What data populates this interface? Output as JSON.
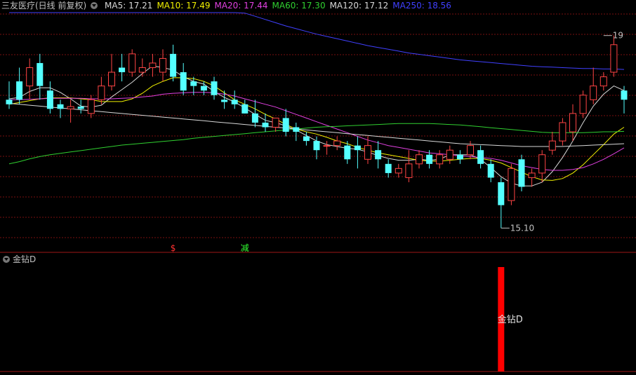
{
  "header": {
    "title": "三友医疗(日线 前复权)",
    "indicators": [
      {
        "label": "MA5:",
        "value": "17.21",
        "color": "#d8d8d8"
      },
      {
        "label": "MA10:",
        "value": "17.49",
        "color": "#f0f000"
      },
      {
        "label": "MA20:",
        "value": "17.44",
        "color": "#e040e0"
      },
      {
        "label": "MA60:",
        "value": "17.30",
        "color": "#30d030"
      },
      {
        "label": "MA120:",
        "value": "17.12",
        "color": "#d8d8d8"
      },
      {
        "label": "MA250:",
        "value": "18.56",
        "color": "#4040ff"
      }
    ]
  },
  "subpanel": {
    "title": "金钻D"
  },
  "colors": {
    "up": "#ff4444",
    "down": "#54ffff",
    "grid": "#7a1010",
    "separator": "#a01818"
  },
  "chart_data": [
    {
      "type": "candlestick",
      "ylim": [
        14.8,
        19.8
      ],
      "grid": true,
      "annotations": [
        {
          "text": "15.10",
          "index": 48,
          "price": 15.1
        },
        {
          "text": "19",
          "index": 58,
          "price": 19.3
        },
        {
          "text": "$",
          "index": 16,
          "color": "#ff3030"
        },
        {
          "text": "减",
          "index": 23,
          "color": "#30ff30"
        }
      ],
      "candles": [
        [
          17.9,
          17.8,
          18.3,
          17.7
        ],
        [
          18.3,
          17.9,
          18.6,
          17.8
        ],
        [
          18.2,
          18.6,
          18.8,
          17.9
        ],
        [
          18.7,
          18.2,
          18.9,
          17.9
        ],
        [
          18.1,
          17.7,
          18.3,
          17.6
        ],
        [
          17.8,
          17.7,
          17.9,
          17.5
        ],
        [
          17.7,
          17.75,
          17.9,
          17.4
        ],
        [
          17.75,
          17.7,
          17.9,
          17.6
        ],
        [
          17.6,
          17.9,
          18.0,
          17.5
        ],
        [
          17.9,
          18.2,
          18.4,
          17.8
        ],
        [
          18.2,
          18.5,
          18.9,
          18.1
        ],
        [
          18.6,
          18.5,
          18.9,
          18.3
        ],
        [
          18.5,
          18.9,
          19.0,
          18.4
        ],
        [
          18.5,
          18.6,
          18.8,
          18.4
        ],
        [
          18.6,
          18.7,
          18.9,
          18.4
        ],
        [
          18.5,
          18.8,
          19.0,
          18.3
        ],
        [
          18.9,
          18.4,
          19.1,
          18.3
        ],
        [
          18.5,
          18.1,
          18.7,
          18.0
        ],
        [
          18.3,
          18.2,
          18.4,
          18.0
        ],
        [
          18.2,
          18.1,
          18.3,
          18.0
        ],
        [
          18.3,
          18.0,
          18.4,
          17.9
        ],
        [
          17.9,
          17.85,
          18.1,
          17.7
        ],
        [
          17.9,
          17.8,
          18.1,
          17.7
        ],
        [
          17.8,
          17.6,
          17.9,
          17.6
        ],
        [
          17.6,
          17.4,
          17.9,
          17.3
        ],
        [
          17.4,
          17.3,
          17.6,
          17.2
        ],
        [
          17.3,
          17.5,
          17.5,
          17.2
        ],
        [
          17.5,
          17.2,
          17.7,
          17.1
        ],
        [
          17.3,
          17.2,
          17.4,
          17.0
        ],
        [
          17.1,
          17.0,
          17.2,
          16.9
        ],
        [
          17.0,
          16.8,
          17.1,
          16.6
        ],
        [
          16.9,
          16.9,
          17.0,
          16.7
        ],
        [
          16.9,
          17.0,
          17.1,
          16.8
        ],
        [
          16.9,
          16.6,
          17.0,
          16.5
        ],
        [
          16.9,
          16.8,
          17.1,
          16.4
        ],
        [
          16.6,
          16.9,
          17.1,
          16.5
        ],
        [
          16.8,
          16.6,
          17.0,
          16.4
        ],
        [
          16.5,
          16.3,
          16.6,
          16.2
        ],
        [
          16.3,
          16.4,
          16.5,
          16.2
        ],
        [
          16.2,
          16.5,
          16.8,
          16.1
        ],
        [
          16.5,
          16.7,
          16.8,
          16.4
        ],
        [
          16.7,
          16.5,
          16.8,
          16.4
        ],
        [
          16.5,
          16.7,
          16.8,
          16.4
        ],
        [
          16.6,
          16.8,
          16.9,
          16.5
        ],
        [
          16.7,
          16.6,
          16.8,
          16.5
        ],
        [
          16.7,
          16.9,
          17.0,
          16.6
        ],
        [
          16.8,
          16.5,
          16.9,
          16.4
        ],
        [
          16.5,
          16.2,
          16.6,
          16.1
        ],
        [
          16.1,
          15.6,
          16.2,
          15.1
        ],
        [
          15.7,
          16.4,
          16.5,
          15.6
        ],
        [
          16.6,
          16.0,
          16.7,
          15.9
        ],
        [
          16.2,
          16.3,
          16.4,
          16.0
        ],
        [
          16.3,
          16.7,
          16.8,
          16.1
        ],
        [
          16.8,
          17.0,
          17.2,
          16.7
        ],
        [
          17.0,
          17.4,
          17.5,
          16.9
        ],
        [
          17.2,
          17.6,
          17.8,
          17.0
        ],
        [
          17.6,
          18.0,
          18.1,
          17.5
        ],
        [
          17.9,
          18.2,
          18.6,
          17.8
        ],
        [
          18.2,
          18.4,
          18.5,
          18.1
        ],
        [
          18.5,
          19.1,
          19.3,
          18.4
        ],
        [
          18.1,
          17.9,
          18.2,
          17.6
        ]
      ],
      "series": [
        {
          "name": "MA5",
          "color": "#d8d8d8",
          "values": [
            17.92,
            17.95,
            18.08,
            18.16,
            18.16,
            18.06,
            17.92,
            17.76,
            17.74,
            17.78,
            17.96,
            18.12,
            18.28,
            18.47,
            18.64,
            18.6,
            18.55,
            18.4,
            18.3,
            18.24,
            18.08,
            17.95,
            17.85,
            17.72,
            17.58,
            17.45,
            17.4,
            17.33,
            17.24,
            17.12,
            17.0,
            16.92,
            16.88,
            16.84,
            16.82,
            16.76,
            16.68,
            16.62,
            16.58,
            16.58,
            16.6,
            16.58,
            16.6,
            16.7,
            16.7,
            16.7,
            16.6,
            16.42,
            16.22,
            16.08,
            16.02,
            16.02,
            16.1,
            16.33,
            16.64,
            17.0,
            17.4,
            17.76,
            18.02,
            18.2,
            18.1
          ]
        },
        {
          "name": "MA10",
          "color": "#f0f000",
          "values": [
            17.8,
            17.84,
            17.88,
            17.92,
            17.94,
            17.94,
            17.94,
            17.92,
            17.9,
            17.86,
            17.86,
            17.86,
            17.92,
            18.04,
            18.2,
            18.3,
            18.38,
            18.38,
            18.36,
            18.3,
            18.2,
            18.05,
            17.9,
            17.8,
            17.7,
            17.58,
            17.48,
            17.36,
            17.26,
            17.2,
            17.15,
            17.08,
            17.0,
            16.94,
            16.86,
            16.8,
            16.74,
            16.7,
            16.66,
            16.62,
            16.58,
            16.56,
            16.56,
            16.58,
            16.6,
            16.62,
            16.62,
            16.58,
            16.52,
            16.42,
            16.32,
            16.22,
            16.15,
            16.14,
            16.18,
            16.3,
            16.48,
            16.7,
            16.92,
            17.15,
            17.3
          ]
        },
        {
          "name": "MA20",
          "color": "#e040e0",
          "values": [
            17.9,
            17.9,
            17.91,
            17.92,
            17.93,
            17.93,
            17.93,
            17.93,
            17.92,
            17.92,
            17.92,
            17.93,
            17.94,
            17.96,
            17.98,
            18.02,
            18.04,
            18.05,
            18.06,
            18.06,
            18.05,
            18.02,
            17.98,
            17.92,
            17.86,
            17.8,
            17.74,
            17.66,
            17.58,
            17.5,
            17.42,
            17.34,
            17.26,
            17.18,
            17.1,
            17.02,
            16.96,
            16.9,
            16.86,
            16.82,
            16.78,
            16.74,
            16.72,
            16.7,
            16.68,
            16.66,
            16.64,
            16.62,
            16.58,
            16.52,
            16.46,
            16.42,
            16.38,
            16.36,
            16.36,
            16.38,
            16.42,
            16.5,
            16.6,
            16.72,
            16.85
          ]
        },
        {
          "name": "MA60",
          "color": "#30d030",
          "values": [
            16.5,
            16.55,
            16.61,
            16.66,
            16.7,
            16.73,
            16.76,
            16.79,
            16.82,
            16.85,
            16.88,
            16.91,
            16.93,
            16.95,
            16.97,
            16.99,
            17.01,
            17.03,
            17.06,
            17.08,
            17.1,
            17.12,
            17.14,
            17.16,
            17.18,
            17.2,
            17.22,
            17.24,
            17.26,
            17.28,
            17.3,
            17.31,
            17.32,
            17.33,
            17.34,
            17.35,
            17.36,
            17.37,
            17.38,
            17.38,
            17.38,
            17.38,
            17.37,
            17.36,
            17.35,
            17.33,
            17.31,
            17.29,
            17.27,
            17.25,
            17.23,
            17.21,
            17.19,
            17.18,
            17.18,
            17.18,
            17.18,
            17.19,
            17.2,
            17.2,
            17.21
          ]
        },
        {
          "name": "MA120",
          "color": "#d8d8d8",
          "values": [
            17.82,
            17.8,
            17.78,
            17.76,
            17.74,
            17.72,
            17.7,
            17.68,
            17.66,
            17.64,
            17.62,
            17.6,
            17.58,
            17.56,
            17.54,
            17.52,
            17.5,
            17.48,
            17.46,
            17.44,
            17.42,
            17.4,
            17.38,
            17.36,
            17.34,
            17.32,
            17.3,
            17.28,
            17.26,
            17.24,
            17.22,
            17.2,
            17.18,
            17.16,
            17.14,
            17.12,
            17.1,
            17.08,
            17.06,
            17.04,
            17.02,
            17.0,
            16.98,
            16.96,
            16.94,
            16.93,
            16.92,
            16.91,
            16.9,
            16.89,
            16.88,
            16.88,
            16.88,
            16.88,
            16.88,
            16.89,
            16.9,
            16.91,
            16.92,
            16.93,
            16.94
          ]
        },
        {
          "name": "MA250",
          "color": "#4040ff",
          "values": [
            21.8,
            21.7,
            21.61,
            21.52,
            21.43,
            21.34,
            21.25,
            21.16,
            21.07,
            20.98,
            20.89,
            20.8,
            20.71,
            20.62,
            20.53,
            20.44,
            20.35,
            20.26,
            20.17,
            20.09,
            20.01,
            19.93,
            19.86,
            19.79,
            19.72,
            19.65,
            19.58,
            19.51,
            19.45,
            19.39,
            19.33,
            19.28,
            19.23,
            19.18,
            19.13,
            19.08,
            19.04,
            19.0,
            18.96,
            18.92,
            18.89,
            18.86,
            18.83,
            18.8,
            18.77,
            18.75,
            18.73,
            18.71,
            18.69,
            18.67,
            18.65,
            18.63,
            18.62,
            18.61,
            18.6,
            18.59,
            18.58,
            18.58,
            18.57,
            18.57,
            18.56
          ]
        }
      ]
    },
    {
      "type": "bar",
      "title": "金钻D",
      "ylim": [
        0,
        1
      ],
      "bars": [
        {
          "index": 48,
          "value": 1,
          "label": "金钻D",
          "color": "#ff0000"
        }
      ]
    }
  ]
}
